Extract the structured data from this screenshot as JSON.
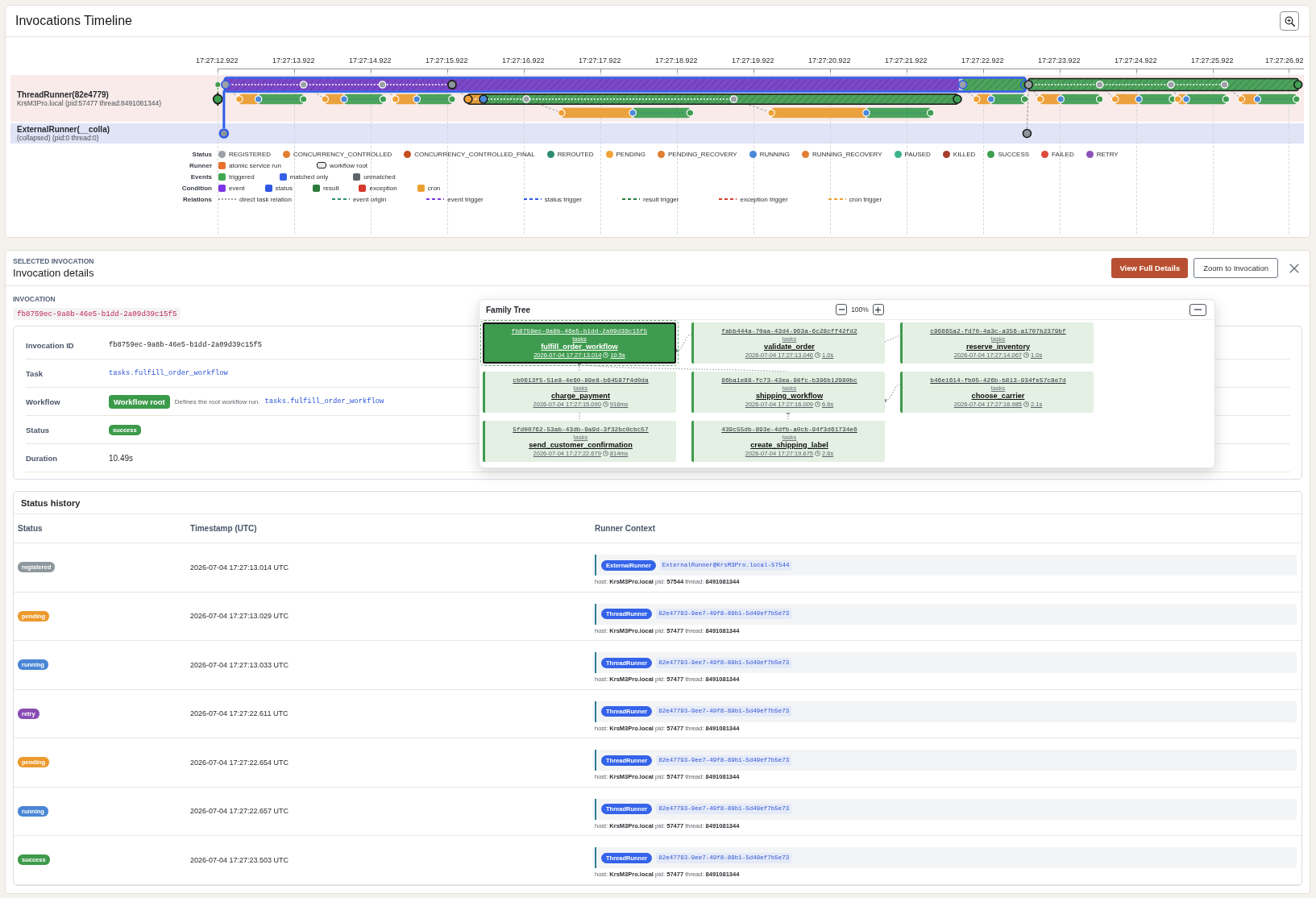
{
  "timeline": {
    "title": "Invocations Timeline",
    "ticks": [
      "17:27:12.922",
      "17:27:13.922",
      "17:27:14.922",
      "17:27:15.922",
      "17:27:16.922",
      "17:27:17.922",
      "17:27:18.922",
      "17:27:19.922",
      "17:27:20.922",
      "17:27:21.922",
      "17:27:22.922",
      "17:27:23.922",
      "17:27:24.922",
      "17:27:25.922",
      "17:27:26.92"
    ],
    "lanes": [
      {
        "kind": "expanded",
        "name": "ThreadRunner(82e4779)",
        "detail": "KrsM3Pro.local (pid:57477 thread:8491081344)"
      },
      {
        "kind": "collapsed",
        "name": "ExternalRunner(__colla)",
        "detail": "(collapsed) (pid:0 thread:0)"
      }
    ],
    "legend": [
      {
        "label": "Status",
        "kind": "status",
        "items": [
          {
            "kind": "dot",
            "text": "REGISTERED",
            "color": "#9aa0a6"
          },
          {
            "kind": "dot",
            "text": "CONCURRENCY_CONTROLLED",
            "color": "#e07f33"
          },
          {
            "kind": "dot",
            "text": "CONCURRENCY_CONTROLLED_FINAL",
            "color": "#c4501e"
          },
          {
            "kind": "dot",
            "text": "REROUTED",
            "color": "#2e8c72"
          },
          {
            "kind": "dot",
            "text": "PENDING",
            "color": "#f0a236"
          },
          {
            "kind": "dot",
            "text": "PENDING_RECOVERY",
            "color": "#e07f33"
          },
          {
            "kind": "dot",
            "text": "RUNNING",
            "color": "#4a88d8"
          },
          {
            "kind": "dot",
            "text": "RUNNING_RECOVERY",
            "color": "#e07f33"
          },
          {
            "kind": "dot",
            "text": "PAUSED",
            "color": "#3db38e"
          },
          {
            "kind": "dot",
            "text": "KILLED",
            "color": "#a63e2e"
          },
          {
            "kind": "dot",
            "text": "SUCCESS",
            "color": "#3f9e50"
          },
          {
            "kind": "dot",
            "text": "FAILED",
            "color": "#df4a3a"
          },
          {
            "kind": "dot",
            "text": "RETRY",
            "color": "#8d52b8"
          }
        ]
      },
      {
        "label": "Runner",
        "kind": "runner",
        "items": [
          {
            "kind": "square",
            "text": "atomic service run",
            "color": "#e8702c"
          },
          {
            "kind": "outline",
            "text": "workflow root"
          }
        ]
      },
      {
        "label": "Events",
        "kind": "events",
        "items": [
          {
            "kind": "square",
            "text": "triggered",
            "color": "#3fa84f"
          },
          {
            "kind": "square",
            "text": "matched only",
            "color": "#3461e8"
          },
          {
            "kind": "square",
            "text": "unmatched",
            "color": "#5e646b"
          }
        ]
      },
      {
        "label": "Condition",
        "kind": "condition",
        "items": [
          {
            "kind": "square",
            "text": "event",
            "color": "#7b35e3"
          },
          {
            "kind": "square",
            "text": "status",
            "color": "#2f56e2"
          },
          {
            "kind": "square",
            "text": "result",
            "color": "#2b7a3c"
          },
          {
            "kind": "square",
            "text": "exception",
            "color": "#d5392b"
          },
          {
            "kind": "square",
            "text": "cron",
            "color": "#eba032"
          }
        ]
      },
      {
        "label": "Relations",
        "kind": "relations",
        "items": [
          {
            "kind": "dotted",
            "text": "direct task relation",
            "color": "#9aa0a6"
          },
          {
            "kind": "dashed",
            "text": "event origin",
            "color": "#2e8c72"
          },
          {
            "kind": "dashed",
            "text": "event trigger",
            "color": "#7b35e3"
          },
          {
            "kind": "dashed",
            "text": "status trigger",
            "color": "#2f56e2"
          },
          {
            "kind": "dashed",
            "text": "result trigger",
            "color": "#2b7a3c"
          },
          {
            "kind": "dashed",
            "text": "exception trigger",
            "color": "#d5392b"
          },
          {
            "kind": "dashed",
            "text": "cron trigger",
            "color": "#eba032"
          }
        ]
      }
    ]
  },
  "details": {
    "eyebrow": "SELECTED INVOCATION",
    "title": "Invocation details",
    "buttons": [
      {
        "label": "View Full Details",
        "kind": "primary"
      },
      {
        "label": "Zoom to Invocation",
        "kind": "secondary"
      }
    ],
    "section_label": "INVOCATION",
    "invocation_id": "fb8759ec-9a8b-46e5-b1dd-2a09d39c15f5",
    "fields": [
      {
        "kind": "mono",
        "label": "Invocation ID",
        "value": "fb8759ec-9a8b-46e5-b1dd-2a09d39c15f5"
      },
      {
        "kind": "link",
        "label": "Task",
        "value": "tasks.fulfill_order_workflow"
      },
      {
        "kind": "workflow",
        "label": "Workflow",
        "badge": "Workflow root",
        "note": "Defines the root workflow run.",
        "value": "tasks.fulfill_order_workflow"
      },
      {
        "kind": "status",
        "label": "Status",
        "value": "success",
        "color": "#3d9a4b"
      },
      {
        "kind": "text",
        "label": "Duration",
        "value": "10.49s"
      }
    ]
  },
  "family_tree": {
    "title": "Family Tree",
    "zoom": "100%",
    "nodes": [
      {
        "id": "fb8759ec-9a8b-46e5-b1dd-2a09d39c15f5",
        "type": "tasks",
        "name": "fulfill_order_workflow",
        "time": "2026-07-04 17:27:13.014",
        "duration": "10.5s",
        "selected": true
      },
      {
        "id": "fabb444a-70aa-43d4-963a-6c28cff42fd2",
        "type": "tasks",
        "name": "validate_order",
        "time": "2026-07-04 17:27:13.046",
        "duration": "1.0s",
        "selected": false
      },
      {
        "id": "c96865a2-fd70-4a3c-a356-a1707b2379bf",
        "type": "tasks",
        "name": "reserve_inventory",
        "time": "2026-07-04 17:27:14.067",
        "duration": "1.0s",
        "selected": false
      },
      {
        "id": "cb0613f5-51e8-4e60-89e8-b64587f4d0da",
        "type": "tasks",
        "name": "charge_payment",
        "time": "2026-07-04 17:27:15.090",
        "duration": "916ms",
        "selected": false
      },
      {
        "id": "86ba1e88-fc73-43ea-98fc-b396b12980bc",
        "type": "tasks",
        "name": "shipping_workflow",
        "time": "2026-07-04 17:27:16.009",
        "duration": "6.6s",
        "selected": false
      },
      {
        "id": "b46e1614-fb05-426b-b813-934fe57c8e7d",
        "type": "tasks",
        "name": "choose_carrier",
        "time": "2026-07-04 17:27:16.985",
        "duration": "2.1s",
        "selected": false
      },
      {
        "id": "5fd00762-53ab-43db-9a9d-3f32bc0cbc57",
        "type": "tasks",
        "name": "send_customer_confirmation",
        "time": "2026-07-04 17:27:22.679",
        "duration": "814ms",
        "selected": false
      },
      {
        "id": "439c55db-893e-4dfb-a0cb-94f3d61734e6",
        "type": "tasks",
        "name": "create_shipping_label",
        "time": "2026-07-04 17:27:19.675",
        "duration": "2.6s",
        "selected": false
      }
    ]
  },
  "status_history": {
    "title": "Status history",
    "columns": [
      "Status",
      "Timestamp (UTC)",
      "Runner Context"
    ],
    "rows": [
      {
        "status": "registered",
        "color": "#8e989c",
        "timestamp": "2026-07-04 17:27:13.014 UTC",
        "runner_type": "ExternalRunner",
        "runner_id": "ExternalRunner@KrsM3Pro.local-57544",
        "runner_info": "host: **KrsM3Pro.local** pid: **57544** thread: **8491081344**"
      },
      {
        "status": "pending",
        "color": "#eb9a2e",
        "timestamp": "2026-07-04 17:27:13.029 UTC",
        "runner_type": "ThreadRunner",
        "runner_id": "82e47793-9ee7-49f8-89b1-5d49ef7b5e73",
        "runner_info": "host: **KrsM3Pro.local** pid: **57477** thread: **8491081344**"
      },
      {
        "status": "running",
        "color": "#4a86d4",
        "timestamp": "2026-07-04 17:27:13.033 UTC",
        "runner_type": "ThreadRunner",
        "runner_id": "82e47793-9ee7-49f8-89b1-5d49ef7b5e73",
        "runner_info": "host: **KrsM3Pro.local** pid: **57477** thread: **8491081344**"
      },
      {
        "status": "retry",
        "color": "#8a4db4",
        "timestamp": "2026-07-04 17:27:22.611 UTC",
        "runner_type": "ThreadRunner",
        "runner_id": "82e47793-9ee7-49f8-89b1-5d49ef7b5e73",
        "runner_info": "host: **KrsM3Pro.local** pid: **57477** thread: **8491081344**"
      },
      {
        "status": "pending",
        "color": "#eb9a2e",
        "timestamp": "2026-07-04 17:27:22.654 UTC",
        "runner_type": "ThreadRunner",
        "runner_id": "82e47793-9ee7-49f8-89b1-5d49ef7b5e73",
        "runner_info": "host: **KrsM3Pro.local** pid: **57477** thread: **8491081344**"
      },
      {
        "status": "running",
        "color": "#4a86d4",
        "timestamp": "2026-07-04 17:27:22.657 UTC",
        "runner_type": "ThreadRunner",
        "runner_id": "82e47793-9ee7-49f8-89b1-5d49ef7b5e73",
        "runner_info": "host: **KrsM3Pro.local** pid: **57477** thread: **8491081344**"
      },
      {
        "status": "success",
        "color": "#3e9a4b",
        "timestamp": "2026-07-04 17:27:23.503 UTC",
        "runner_type": "ThreadRunner",
        "runner_id": "82e47793-9ee7-49f8-89b1-5d49ef7b5e73",
        "runner_info": "host: **KrsM3Pro.local** pid: **57477** thread: **8491081344**"
      }
    ]
  }
}
